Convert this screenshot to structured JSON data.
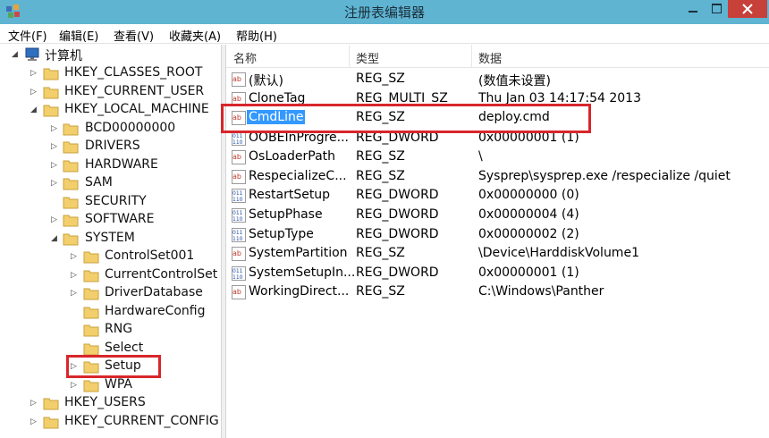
{
  "window": {
    "title": "注册表编辑器",
    "accent_titlebar": "#5fb4d2",
    "accent_close": "#c7403a",
    "highlight_border": "#d8262b",
    "selection": "#3399ff"
  },
  "menu": {
    "file": "文件(F)",
    "edit": "编辑(E)",
    "view": "查看(V)",
    "favorites": "收藏夹(A)",
    "help": "帮助(H)"
  },
  "tree": {
    "root": "计算机",
    "hkcr": "HKEY_CLASSES_ROOT",
    "hkcu": "HKEY_CURRENT_USER",
    "hklm": "HKEY_LOCAL_MACHINE",
    "bcd": "BCD00000000",
    "drivers": "DRIVERS",
    "hardware": "HARDWARE",
    "sam": "SAM",
    "security": "SECURITY",
    "software": "SOFTWARE",
    "system": "SYSTEM",
    "controlset001": "ControlSet001",
    "currentcontrolset": "CurrentControlSet",
    "driverdatabase": "DriverDatabase",
    "hardwareconfig": "HardwareConfig",
    "rng": "RNG",
    "select": "Select",
    "setup": "Setup",
    "wpa": "WPA",
    "hku": "HKEY_USERS",
    "hkcc": "HKEY_CURRENT_CONFIG"
  },
  "list": {
    "headers": {
      "name": "名称",
      "type": "类型",
      "data": "数据"
    },
    "rows": [
      {
        "icon": "string-value-icon",
        "name": "(默认)",
        "type": "REG_SZ",
        "data": "(数值未设置)"
      },
      {
        "icon": "string-value-icon",
        "name": "CloneTag",
        "type": "REG_MULTI_SZ",
        "data": "Thu Jan 03 14:17:54 2013"
      },
      {
        "icon": "string-value-icon",
        "name": "CmdLine",
        "type": "REG_SZ",
        "data": "deploy.cmd"
      },
      {
        "icon": "binary-value-icon",
        "name": "OOBEInProgre...",
        "type": "REG_DWORD",
        "data": "0x00000001 (1)"
      },
      {
        "icon": "string-value-icon",
        "name": "OsLoaderPath",
        "type": "REG_SZ",
        "data": "\\"
      },
      {
        "icon": "string-value-icon",
        "name": "RespecializeC...",
        "type": "REG_SZ",
        "data": "Sysprep\\sysprep.exe /respecialize /quiet"
      },
      {
        "icon": "binary-value-icon",
        "name": "RestartSetup",
        "type": "REG_DWORD",
        "data": "0x00000000 (0)"
      },
      {
        "icon": "binary-value-icon",
        "name": "SetupPhase",
        "type": "REG_DWORD",
        "data": "0x00000004 (4)"
      },
      {
        "icon": "binary-value-icon",
        "name": "SetupType",
        "type": "REG_DWORD",
        "data": "0x00000002 (2)"
      },
      {
        "icon": "string-value-icon",
        "name": "SystemPartition",
        "type": "REG_SZ",
        "data": "\\Device\\HarddiskVolume1"
      },
      {
        "icon": "binary-value-icon",
        "name": "SystemSetupIn...",
        "type": "REG_DWORD",
        "data": "0x00000001 (1)"
      },
      {
        "icon": "string-value-icon",
        "name": "WorkingDirect...",
        "type": "REG_SZ",
        "data": "C:\\Windows\\Panther"
      }
    ]
  }
}
